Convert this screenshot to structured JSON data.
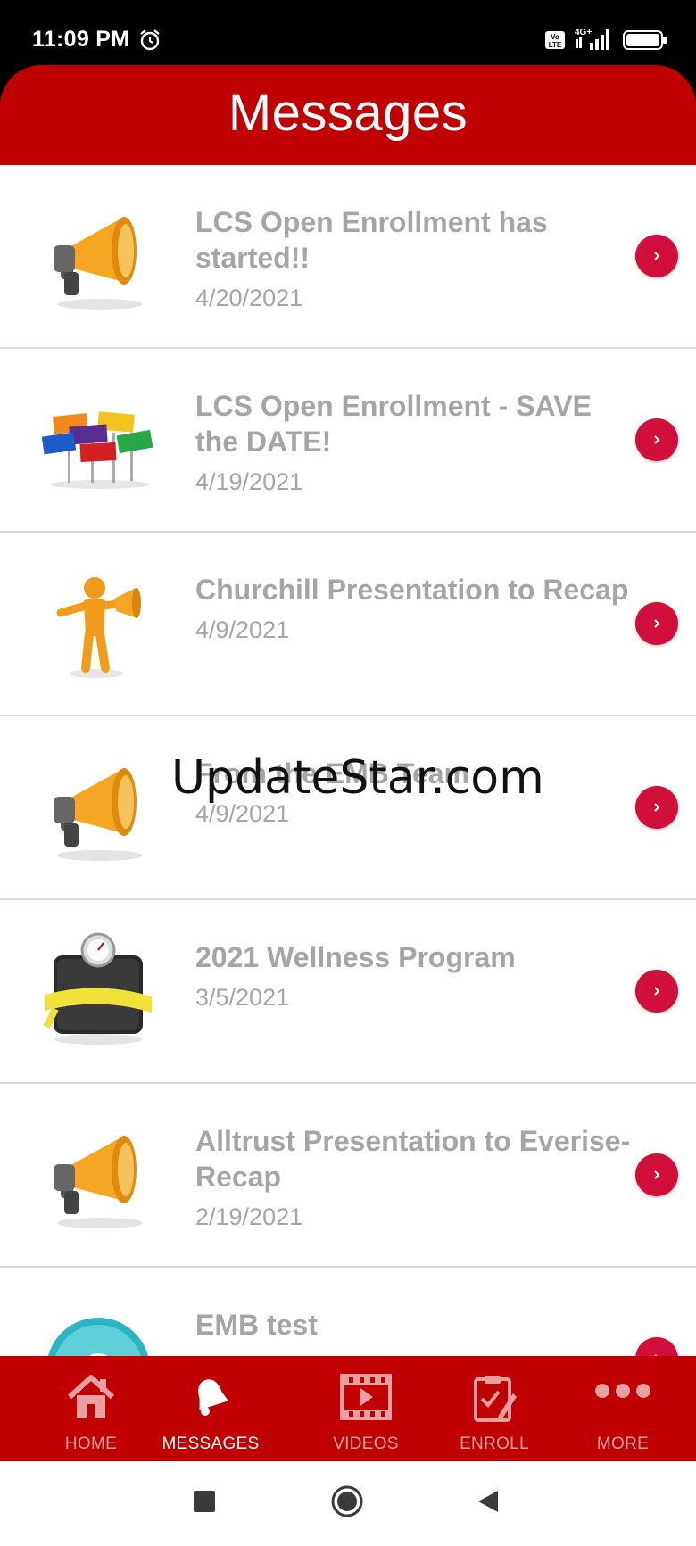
{
  "status_bar": {
    "time": "11:09 PM",
    "icons": [
      "alarm-icon",
      "volte-icon",
      "signal-4g-icon",
      "battery-icon"
    ]
  },
  "header": {
    "title": "Messages"
  },
  "messages": [
    {
      "title": "LCS Open Enrollment has started!!",
      "date": "4/20/2021",
      "icon": "megaphone-icon"
    },
    {
      "title": "LCS Open Enrollment - SAVE the DATE!",
      "date": "4/19/2021",
      "icon": "question-signs-icon"
    },
    {
      "title": "Churchill Presentation to Recap",
      "date": "4/9/2021",
      "icon": "figure-megaphone-icon"
    },
    {
      "title": "From the EMB Team",
      "date": "4/9/2021",
      "icon": "megaphone-icon"
    },
    {
      "title": "2021 Wellness Program",
      "date": "3/5/2021",
      "icon": "scale-tape-icon"
    },
    {
      "title": "Alltrust Presentation to Everise-Recap",
      "date": "2/19/2021",
      "icon": "megaphone-icon"
    },
    {
      "title": "EMB test",
      "date": "",
      "icon": "disc-icon"
    }
  ],
  "watermark": "UpdateStar.com",
  "bottom_nav": [
    {
      "label": "HOME",
      "icon": "home-icon",
      "active": false
    },
    {
      "label": "MESSAGES",
      "icon": "bell-icon",
      "active": true
    },
    {
      "label": "VIDEOS",
      "icon": "video-icon",
      "active": false
    },
    {
      "label": "ENROLL",
      "icon": "clipboard-icon",
      "active": false
    },
    {
      "label": "MORE",
      "icon": "more-dots-icon",
      "active": false
    }
  ],
  "colors": {
    "brand_red": "#c00000",
    "chevron_red": "#d0103a",
    "text_gray": "#a5a5a5"
  }
}
